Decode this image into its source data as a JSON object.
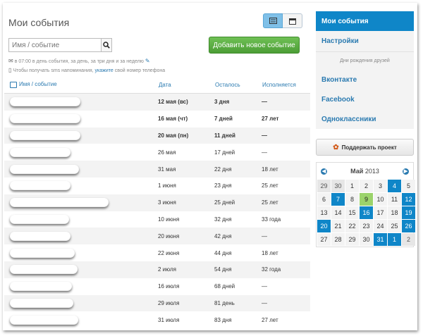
{
  "page": {
    "title": "Мои события"
  },
  "search": {
    "placeholder": "Имя / событие"
  },
  "add_button": "Добавить новое событие",
  "notes": {
    "reminder": "в 07:00 в день события, за день, за три дня и за неделю",
    "phone_prefix": "Чтобы получать sms напоминания,",
    "phone_link": "укажите",
    "phone_suffix": "свой номер телефона"
  },
  "table": {
    "headers": [
      "Имя / событие",
      "Дата",
      "Осталось",
      "Исполняется"
    ],
    "rows": [
      {
        "date": "12 мая (вс)",
        "left": "3 дня",
        "age": "—",
        "bold": true
      },
      {
        "date": "16 мая (чт)",
        "left": "7 дней",
        "age": "27 лет",
        "bold": true
      },
      {
        "date": "20 мая (пн)",
        "left": "11 дней",
        "age": "—",
        "bold": true
      },
      {
        "date": "26 мая",
        "left": "17 дней",
        "age": "—",
        "bold": false
      },
      {
        "date": "31 мая",
        "left": "22 дня",
        "age": "18 лет",
        "bold": false
      },
      {
        "date": "1 июня",
        "left": "23 дня",
        "age": "25 лет",
        "bold": false
      },
      {
        "date": "3 июня",
        "left": "25 дней",
        "age": "25 лет",
        "bold": false
      },
      {
        "date": "10 июня",
        "left": "32 дня",
        "age": "33 года",
        "bold": false
      },
      {
        "date": "20 июня",
        "left": "42 дня",
        "age": "—",
        "bold": false
      },
      {
        "date": "22 июня",
        "left": "44 дня",
        "age": "18 лет",
        "bold": false
      },
      {
        "date": "2 июля",
        "left": "54 дня",
        "age": "32 года",
        "bold": false
      },
      {
        "date": "16 июля",
        "left": "68 дней",
        "age": "—",
        "bold": false
      },
      {
        "date": "29 июля",
        "left": "81 день",
        "age": "—",
        "bold": false
      },
      {
        "date": "31 июля",
        "left": "83 дня",
        "age": "27 лет",
        "bold": false
      }
    ]
  },
  "sidebar": {
    "items": [
      "Мои события",
      "Настройки"
    ],
    "birthdays_heading": "Дни рождения друзей",
    "social": [
      "Вконтакте",
      "Facebook",
      "Одноклассники"
    ],
    "support_button": "Поддержать проект"
  },
  "calendar": {
    "month": "Май",
    "year": "2013",
    "weeks": [
      [
        {
          "d": "29",
          "t": "other"
        },
        {
          "d": "30",
          "t": "other"
        },
        {
          "d": "1",
          "t": ""
        },
        {
          "d": "2",
          "t": ""
        },
        {
          "d": "3",
          "t": ""
        },
        {
          "d": "4",
          "t": "ev"
        },
        {
          "d": "5",
          "t": ""
        }
      ],
      [
        {
          "d": "6",
          "t": ""
        },
        {
          "d": "7",
          "t": "ev"
        },
        {
          "d": "8",
          "t": ""
        },
        {
          "d": "9",
          "t": "today"
        },
        {
          "d": "10",
          "t": ""
        },
        {
          "d": "11",
          "t": ""
        },
        {
          "d": "12",
          "t": "ev"
        }
      ],
      [
        {
          "d": "13",
          "t": ""
        },
        {
          "d": "14",
          "t": ""
        },
        {
          "d": "15",
          "t": ""
        },
        {
          "d": "16",
          "t": "ev"
        },
        {
          "d": "17",
          "t": ""
        },
        {
          "d": "18",
          "t": ""
        },
        {
          "d": "19",
          "t": "ev"
        }
      ],
      [
        {
          "d": "20",
          "t": "ev"
        },
        {
          "d": "21",
          "t": ""
        },
        {
          "d": "22",
          "t": ""
        },
        {
          "d": "23",
          "t": ""
        },
        {
          "d": "24",
          "t": ""
        },
        {
          "d": "25",
          "t": ""
        },
        {
          "d": "26",
          "t": "ev"
        }
      ],
      [
        {
          "d": "27",
          "t": ""
        },
        {
          "d": "28",
          "t": ""
        },
        {
          "d": "29",
          "t": ""
        },
        {
          "d": "30",
          "t": ""
        },
        {
          "d": "31",
          "t": "ev"
        },
        {
          "d": "1",
          "t": "ev"
        },
        {
          "d": "2",
          "t": "other"
        }
      ]
    ]
  },
  "colors": {
    "accent": "#0f86c8",
    "add_button": "#5cb043",
    "today": "#9bd36b",
    "link": "#2a7ab0"
  }
}
